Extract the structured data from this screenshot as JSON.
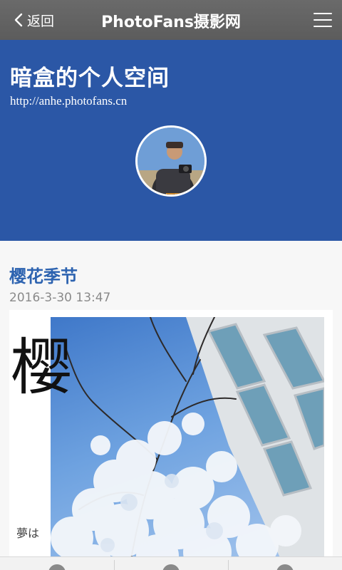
{
  "topbar": {
    "back_label": "返回",
    "title": "PhotoFans摄影网",
    "back_icon": "chevron-left-icon",
    "menu_icon": "hamburger-menu-icon"
  },
  "profile": {
    "space_title": "暗盒的个人空间",
    "url": "http://anhe.photofans.cn",
    "header_color": "#2b57a6"
  },
  "post": {
    "title": "樱花季节",
    "date": "2016-3-30 13:47",
    "title_color": "#2d63b0",
    "image": {
      "calligraphy_text": "樱",
      "caption_text": "夢は"
    }
  },
  "bottom_bar": {
    "tabs": [
      {
        "icon": "tab-icon-1"
      },
      {
        "icon": "tab-icon-2"
      },
      {
        "icon": "tab-icon-3"
      }
    ]
  }
}
